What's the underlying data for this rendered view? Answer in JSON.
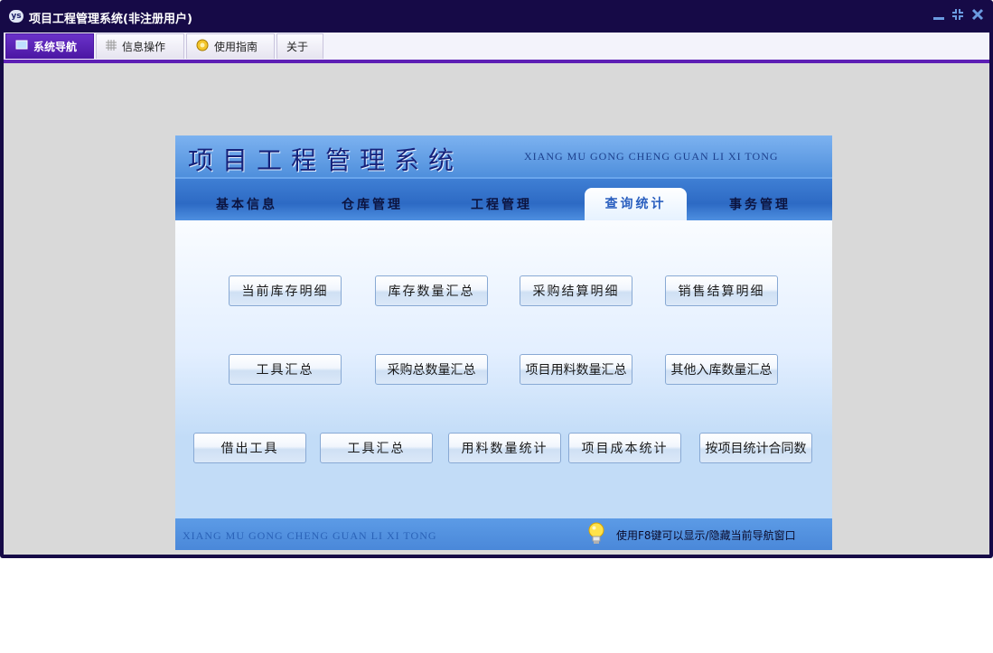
{
  "window": {
    "title": "项目工程管理系统(非注册用户)",
    "app_icon_text": "ys"
  },
  "menu": {
    "tabs": [
      {
        "label": "系统导航",
        "icon": "monitor-icon"
      },
      {
        "label": "信息操作",
        "icon": "grid-icon"
      },
      {
        "label": "使用指南",
        "icon": "help-icon"
      },
      {
        "label": "关于",
        "icon": ""
      }
    ]
  },
  "panel": {
    "title": "项目工程管理系统",
    "subtitle": "XIANG MU GONG CHENG GUAN LI XI TONG",
    "tabs": [
      "基本信息",
      "仓库管理",
      "工程管理",
      "查询统计",
      "事务管理"
    ],
    "active_tab": "查询统计",
    "buttons": {
      "row1": [
        "当前库存明细",
        "库存数量汇总",
        "采购结算明细",
        "销售结算明细"
      ],
      "row2": [
        "工具汇总",
        "采购总数量汇总",
        "项目用料数量汇总",
        "其他入库数量汇总"
      ],
      "row3": [
        "借出工具",
        "工具汇总",
        "用料数量统计",
        "项目成本统计",
        "按项目统计合同数"
      ]
    },
    "footer_subtitle": "XIANG MU GONG CHENG GUAN LI XI TONG",
    "footer_hint": "使用F8键可以显示/隐藏当前导航窗口"
  },
  "colors": {
    "title_bar": "#160a47",
    "menu_active": "#5d1fb5",
    "banner": "#4f8fdc",
    "title_text": "#16227a",
    "client_bg": "#d9d9d9"
  }
}
